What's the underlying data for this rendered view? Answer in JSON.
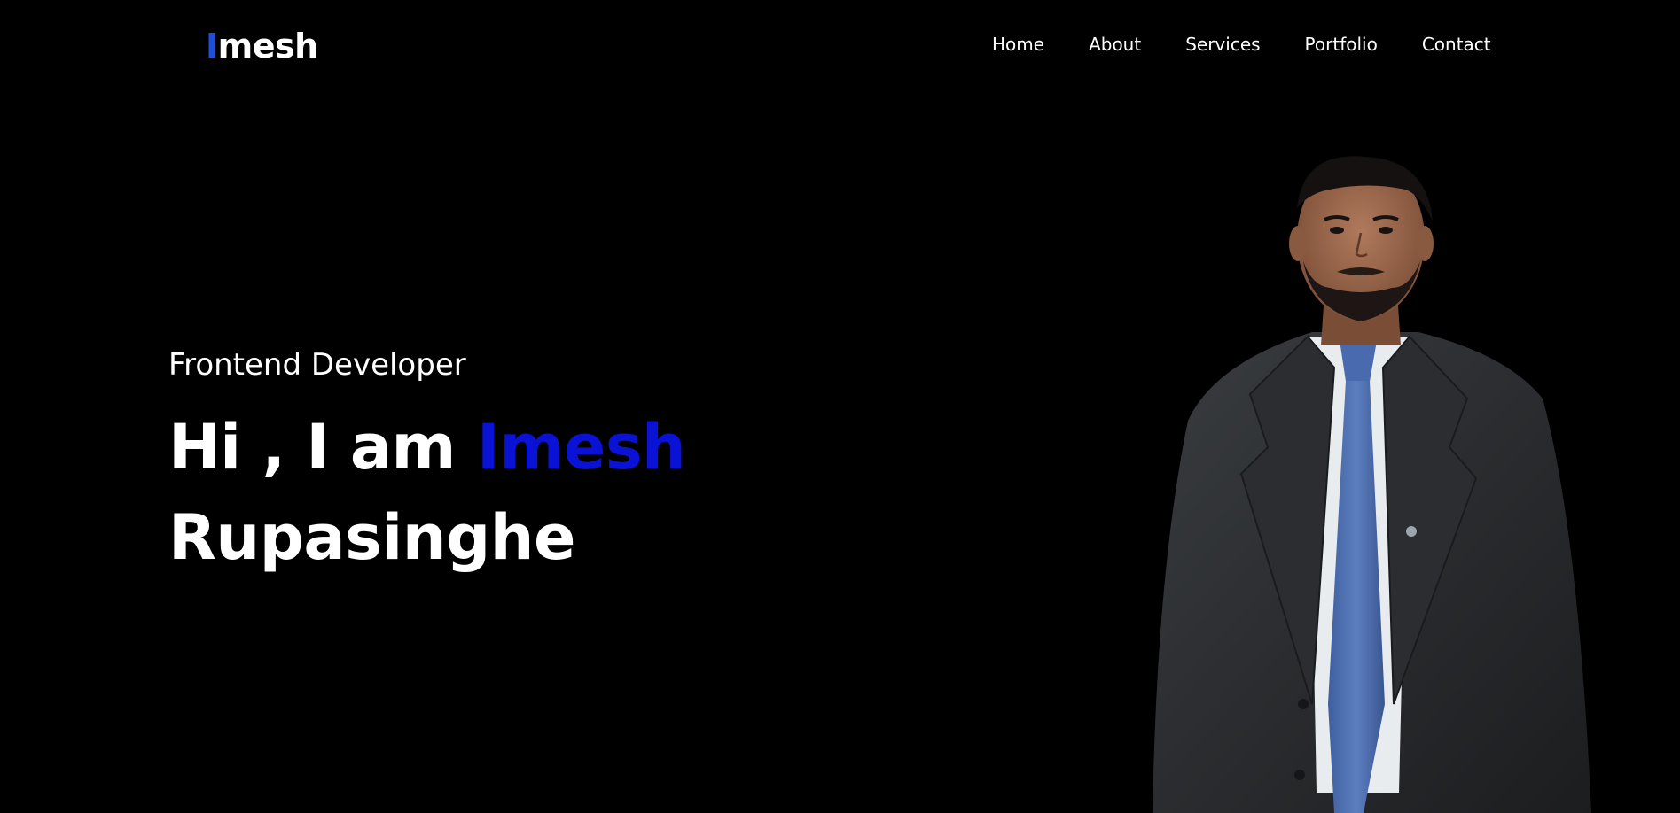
{
  "header": {
    "logo_first_letter": "I",
    "logo_rest": "mesh",
    "nav": [
      {
        "label": "Home"
      },
      {
        "label": "About"
      },
      {
        "label": "Services"
      },
      {
        "label": "Portfolio"
      },
      {
        "label": "Contact"
      }
    ]
  },
  "hero": {
    "role": "Frontend Developer",
    "greeting": "Hi , I am ",
    "first_name": "Imesh",
    "last_name": "Rupasinghe"
  },
  "colors": {
    "background": "#000000",
    "text": "#ffffff",
    "accent": "#0a12d6",
    "logo_accent": "#1f4fd8"
  },
  "portrait": {
    "icon": "person-portrait-photo"
  }
}
